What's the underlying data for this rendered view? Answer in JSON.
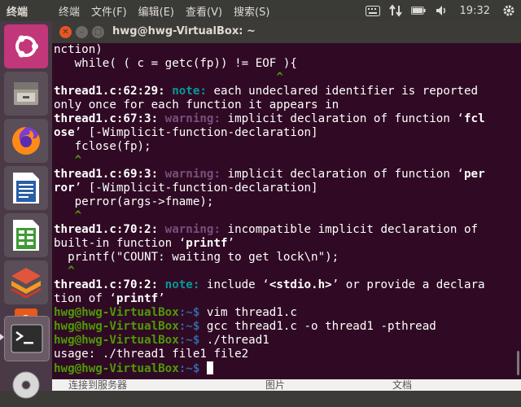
{
  "top_panel": {
    "app_name": "终端",
    "menus": [
      "终端",
      "文件(F)",
      "编辑(E)",
      "查看(V)",
      "搜索(S)",
      "…"
    ],
    "clock": "19:32"
  },
  "launcher": {
    "items": [
      {
        "name": "ubuntu-dash-icon"
      },
      {
        "name": "files-icon"
      },
      {
        "name": "firefox-icon"
      },
      {
        "name": "writer-icon"
      },
      {
        "name": "calc-icon"
      },
      {
        "name": "impress-icon"
      },
      {
        "name": "software-icon"
      },
      {
        "name": "terminal-icon"
      },
      {
        "name": "disc-icon"
      }
    ]
  },
  "window": {
    "title": "hwg@hwg-VirtualBox: ~"
  },
  "terminal": {
    "prompt_user": "hwg@hwg-VirtualBox",
    "prompt_path": ":~$",
    "lines": {
      "l1": "nction)",
      "l2": "   while( ( c = getc(fp)) != EOF ){",
      "l3": "                                ^",
      "l4_loc": "thread1.c:62:29: ",
      "l4_tag": "note:",
      "l4_msg": " each undeclared identifier is reported",
      "l5": "only once for each function it appears in",
      "l6_loc": "thread1.c:67:3: ",
      "l6_tag": "warning:",
      "l6_msg": " implicit declaration of function ‘",
      "l6_fn": "fcl",
      "l7_fn": "ose",
      "l7_msg": "’ [-Wimplicit-function-declaration]",
      "l8": "   fclose(fp);",
      "l9": "   ^",
      "l10_loc": "thread1.c:69:3: ",
      "l10_tag": "warning:",
      "l10_msg": " implicit declaration of function ‘",
      "l10_fn": "per",
      "l11_fn": "ror",
      "l11_msg": "’ [-Wimplicit-function-declaration]",
      "l12": "   perror(args->fname);",
      "l13": "   ^",
      "l14_loc": "thread1.c:70:2: ",
      "l14_tag": "warning:",
      "l14_msg": " incompatible implicit declaration of",
      "l15_msg": "built-in function ‘",
      "l15_fn": "printf",
      "l15_end": "’",
      "l16": "  printf(\"COUNT: waiting to get lock\\n\");",
      "l17": "  ^",
      "l18_loc": "thread1.c:70:2: ",
      "l18_tag": "note:",
      "l18_msg": " include ‘",
      "l18_hdr": "<stdio.h>",
      "l18_end": "’ or provide a declara",
      "l19_msg": "tion of ‘",
      "l19_fn": "printf",
      "l19_end": "’",
      "cmd1": " vim thread1.c",
      "cmd2": " gcc thread1.c -o thread1 -pthread",
      "cmd3": " ./thread1",
      "usage": "usage: ./thread1 file1 file2",
      "cmd4": " "
    }
  },
  "behind": {
    "texts": [
      "连接到服务器",
      "图片",
      "文档"
    ]
  }
}
